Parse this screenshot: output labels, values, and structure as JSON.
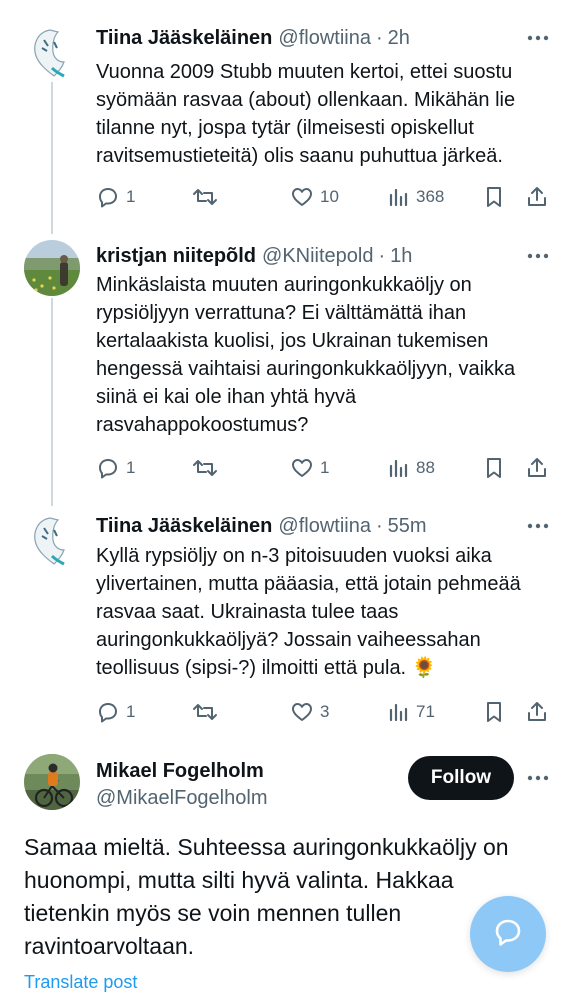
{
  "tweets": [
    {
      "name": "Tiina Jääskeläinen",
      "handle": "@flowtiina",
      "sep": "·",
      "time": "2h",
      "text": "Vuonna 2009 Stubb muuten kertoi, ettei suostu syömään rasvaa (about) ollenkaan. Mikähän lie tilanne nyt, jospa tytär (ilmeisesti opiskellut ravitsemustieteitä) olis saanu puhuttua järkeä.",
      "replies": "1",
      "retweets": "",
      "likes": "10",
      "views": "368"
    },
    {
      "name": "kristjan niitepõld",
      "handle": "@KNiitepold",
      "sep": "·",
      "time": "1h",
      "text": "Minkäslaista muuten auringonkukkaöljy on rypsiöljyyn verrattuna? Ei välttämättä ihan kertalaakista kuolisi, jos Ukrainan tukemisen hengessä vaihtaisi auringonkukkaöljyyn, vaikka siinä ei kai ole ihan yhtä hyvä rasvahappokoostumus?",
      "replies": "1",
      "retweets": "",
      "likes": "1",
      "views": "88"
    },
    {
      "name": "Tiina Jääskeläinen",
      "handle": "@flowtiina",
      "sep": "·",
      "time": "55m",
      "text": "Kyllä rypsiöljy on n-3 pitoisuuden vuoksi aika ylivertainen, mutta pääasia, että jotain pehmeää rasvaa saat. Ukrainasta tulee taas auringonkukkaöljyä? Jossain vaiheessahan teollisuus (sipsi-?) ilmoitti että pula. 🌻",
      "replies": "1",
      "retweets": "",
      "likes": "3",
      "views": "71"
    }
  ],
  "main": {
    "name": "Mikael Fogelholm",
    "handle": "@MikaelFogelholm",
    "follow_label": "Follow",
    "text": "Samaa mieltä. Suhteessa auringonkukkaöljy on huonompi, mutta silti hyvä valinta. Hakkaa tietenkin myös se voin mennen tullen ravintoarvoltaan.",
    "translate_label": "Translate post"
  },
  "icons": {
    "reply": "reply-icon",
    "retweet": "retweet-icon",
    "like": "heart-icon",
    "views": "views-icon",
    "bookmark": "bookmark-icon",
    "share": "share-icon",
    "more": "more-icon",
    "compose": "compose-reply-icon"
  },
  "colors": {
    "text": "#0f1419",
    "secondary": "#536471",
    "accent": "#1d9bf0",
    "follow_bg": "#0f1419",
    "fab_bg": "#8ec8f6",
    "thread_line": "#cfd9de"
  }
}
